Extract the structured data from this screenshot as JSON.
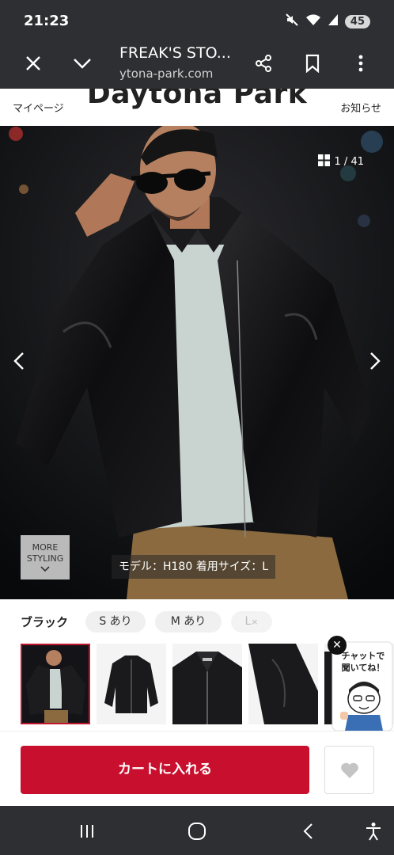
{
  "status_bar": {
    "time": "21:23",
    "battery": "45"
  },
  "browser": {
    "title": "FREAK'S STO...",
    "url": "ytona-park.com"
  },
  "site_header": {
    "logo": "Daytona Park",
    "mypage": "マイページ",
    "notice": "お知らせ"
  },
  "hero": {
    "counter": "1 / 41",
    "more_styling_line1": "MORE",
    "more_styling_line2": "STYLING",
    "caption": "モデル：H180 着用サイズ：L"
  },
  "product": {
    "color": "ブラック",
    "sizes": [
      {
        "label": "S あり"
      },
      {
        "label": "M あり"
      },
      {
        "label": "L",
        "mark": "×"
      }
    ]
  },
  "chat": {
    "line1": "チャットで",
    "line2": "聞いてね！"
  },
  "actions": {
    "cart": "カートに入れる"
  },
  "colors": {
    "accent": "#c8102e",
    "bar_bg": "#2e2f32"
  }
}
